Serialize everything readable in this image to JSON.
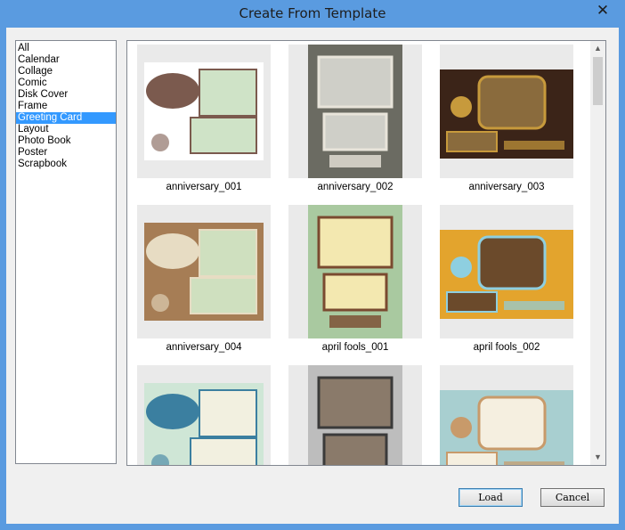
{
  "window": {
    "title": "Create From Template",
    "close_glyph": "✕"
  },
  "categories": [
    {
      "label": "All"
    },
    {
      "label": "Calendar"
    },
    {
      "label": "Collage"
    },
    {
      "label": "Comic"
    },
    {
      "label": "Disk Cover"
    },
    {
      "label": "Frame"
    },
    {
      "label": "Greeting Card",
      "selected": true
    },
    {
      "label": "Layout"
    },
    {
      "label": "Photo Book"
    },
    {
      "label": "Poster"
    },
    {
      "label": "Scrapbook"
    }
  ],
  "templates": [
    {
      "name": "anniversary_001",
      "bg": "#ffffff",
      "accent": "#7b5a4e",
      "frame": "#cfe3c7"
    },
    {
      "name": "anniversary_002",
      "bg": "#6b6b62",
      "accent": "#e8e4da",
      "frame": "#cfcfc8"
    },
    {
      "name": "anniversary_003",
      "bg": "#3b2418",
      "accent": "#c79a3c",
      "frame": "#8a6b3d"
    },
    {
      "name": "anniversary_004",
      "bg": "#a67d55",
      "accent": "#e7dcc3",
      "frame": "#cfe0bf"
    },
    {
      "name": "april fools_001",
      "bg": "#a9c9a0",
      "accent": "#7a4a30",
      "frame": "#f3e8b0"
    },
    {
      "name": "april fools_002",
      "bg": "#e3a42d",
      "accent": "#8ecfe0",
      "frame": "#6b4a2b"
    },
    {
      "name": "",
      "bg": "#cfe6d6",
      "accent": "#3b7fa0",
      "frame": "#f2f0e0"
    },
    {
      "name": "",
      "bg": "#bdbdbd",
      "accent": "#3a3a3a",
      "frame": "#8a7a6a"
    },
    {
      "name": "",
      "bg": "#a8cfd0",
      "accent": "#c89a6a",
      "frame": "#f5efe0"
    }
  ],
  "icons": {
    "scroll_up": "▲",
    "scroll_down": "▼"
  },
  "buttons": {
    "load": "Load",
    "cancel": "Cancel"
  }
}
